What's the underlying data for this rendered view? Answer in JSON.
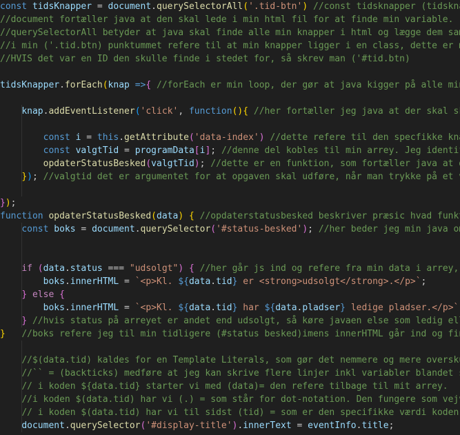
{
  "editor": {
    "language": "javascript",
    "colors": {
      "background": "#1f1f1f",
      "plain": "#cccccc",
      "keyword": "#569cd6",
      "control": "#c586c0",
      "variable": "#9cdcfe",
      "function": "#dcdcaa",
      "string": "#ce9178",
      "comment": "#6a9955",
      "bracket_gold": "#ffd700",
      "bracket_purple": "#da70d6",
      "bracket_blue": "#179fff"
    },
    "lines": [
      [
        [
          "keyword",
          "const "
        ],
        [
          "var",
          "tidsKnapper"
        ],
        [
          "plain",
          " = "
        ],
        [
          "var",
          "document"
        ],
        [
          "plain",
          "."
        ],
        [
          "func",
          "querySelectorAll"
        ],
        [
          "bracket-1",
          "("
        ],
        [
          "string",
          "'.tid-btn'"
        ],
        [
          "bracket-1",
          ")"
        ],
        [
          "plain",
          " "
        ],
        [
          "comment",
          "//const tidsknapper (tidsknap"
        ]
      ],
      [
        [
          "comment",
          "//document fortæller java at den skal lede i min html fil for at finde min variable."
        ]
      ],
      [
        [
          "comment",
          "//querySelectorAll betyder at java skal finde alle min knapper i html og lægge dem samm"
        ]
      ],
      [
        [
          "comment",
          "//i min ('.tid.btn) punktummet refere til at min knapper ligger i en class, dette er me"
        ]
      ],
      [
        [
          "comment",
          "//HVIS det var en ID den skulle finde i stedet for, så skrev man ('#tid.btn)"
        ]
      ],
      [],
      [
        [
          "var",
          "tidsKnapper"
        ],
        [
          "plain",
          "."
        ],
        [
          "func",
          "forEach"
        ],
        [
          "bracket-1",
          "("
        ],
        [
          "var",
          "knap"
        ],
        [
          "plain",
          " "
        ],
        [
          "keyword",
          "=>"
        ],
        [
          "bracket-2",
          "{"
        ],
        [
          "plain",
          " "
        ],
        [
          "comment",
          "//forEach er min loop, der gør at java kigger på alle min"
        ]
      ],
      [],
      [
        [
          "plain",
          "    "
        ],
        [
          "var",
          "knap"
        ],
        [
          "plain",
          "."
        ],
        [
          "func",
          "addEventListener"
        ],
        [
          "bracket-3",
          "("
        ],
        [
          "string",
          "'click'"
        ],
        [
          "plain",
          ", "
        ],
        [
          "keyword",
          "function"
        ],
        [
          "bracket-1",
          "()"
        ],
        [
          "bracket-1",
          "{"
        ],
        [
          "plain",
          " "
        ],
        [
          "comment",
          "//her fortæller jeg java at der skal ske"
        ]
      ],
      [],
      [
        [
          "plain",
          "        "
        ],
        [
          "keyword",
          "const "
        ],
        [
          "var",
          "i"
        ],
        [
          "plain",
          " = "
        ],
        [
          "keyword",
          "this"
        ],
        [
          "plain",
          "."
        ],
        [
          "func",
          "getAttribute"
        ],
        [
          "bracket-2",
          "("
        ],
        [
          "string",
          "'data-index'"
        ],
        [
          "bracket-2",
          ")"
        ],
        [
          "plain",
          " "
        ],
        [
          "comment",
          "//dette refere til den specfikke knap"
        ]
      ],
      [
        [
          "plain",
          "        "
        ],
        [
          "keyword",
          "const "
        ],
        [
          "var",
          "valgtTid"
        ],
        [
          "plain",
          " = "
        ],
        [
          "var",
          "programData"
        ],
        [
          "bracket-2",
          "["
        ],
        [
          "var",
          "i"
        ],
        [
          "bracket-2",
          "]"
        ],
        [
          "plain",
          "; "
        ],
        [
          "comment",
          "//denne del kobles til min arrey. Jeg identifi"
        ]
      ],
      [
        [
          "plain",
          "        "
        ],
        [
          "func",
          "opdaterStatusBesked"
        ],
        [
          "bracket-2",
          "("
        ],
        [
          "var",
          "valgtTid"
        ],
        [
          "bracket-2",
          ")"
        ],
        [
          "plain",
          "; "
        ],
        [
          "comment",
          "//dette er en funktion, som fortæller java at de"
        ]
      ],
      [
        [
          "plain",
          "    "
        ],
        [
          "bracket-1",
          "}"
        ],
        [
          "bracket-3",
          ")"
        ],
        [
          "plain",
          "; "
        ],
        [
          "comment",
          "//valgtid det er argumentet for at opgaven skal udføre, når man trykke på et va"
        ]
      ],
      [],
      [
        [
          "bracket-2",
          "}"
        ],
        [
          "bracket-1",
          ")"
        ],
        [
          "plain",
          ";"
        ]
      ],
      [
        [
          "keyword",
          "function "
        ],
        [
          "func",
          "opdaterStatusBesked"
        ],
        [
          "bracket-1",
          "("
        ],
        [
          "var",
          "data"
        ],
        [
          "bracket-1",
          ")"
        ],
        [
          "plain",
          " "
        ],
        [
          "bracket-1",
          "{"
        ],
        [
          "plain",
          " "
        ],
        [
          "comment",
          "//opdaterstatusbesked beskriver præsic hvad funkti"
        ]
      ],
      [
        [
          "plain",
          "    "
        ],
        [
          "keyword",
          "const "
        ],
        [
          "var",
          "boks"
        ],
        [
          "plain",
          " = "
        ],
        [
          "var",
          "document"
        ],
        [
          "plain",
          "."
        ],
        [
          "func",
          "querySelector"
        ],
        [
          "bracket-2",
          "("
        ],
        [
          "string",
          "'#status-besked'"
        ],
        [
          "bracket-2",
          ")"
        ],
        [
          "plain",
          "; "
        ],
        [
          "comment",
          "//her beder jeg min java om"
        ]
      ],
      [],
      [],
      [
        [
          "plain",
          "    "
        ],
        [
          "control",
          "if"
        ],
        [
          "plain",
          " "
        ],
        [
          "bracket-2",
          "("
        ],
        [
          "var",
          "data"
        ],
        [
          "plain",
          "."
        ],
        [
          "var",
          "status"
        ],
        [
          "plain",
          " === "
        ],
        [
          "string",
          "\"udsolgt\""
        ],
        [
          "bracket-2",
          ")"
        ],
        [
          "plain",
          " "
        ],
        [
          "bracket-2",
          "{"
        ],
        [
          "plain",
          " "
        ],
        [
          "comment",
          "//her går js ind og refere fra min data i arrey, h"
        ]
      ],
      [
        [
          "plain",
          "        "
        ],
        [
          "var",
          "boks"
        ],
        [
          "plain",
          "."
        ],
        [
          "var",
          "innerHTML"
        ],
        [
          "plain",
          " = "
        ],
        [
          "string",
          "`<p>Kl. "
        ],
        [
          "interp",
          "${"
        ],
        [
          "var",
          "data"
        ],
        [
          "plain",
          "."
        ],
        [
          "var",
          "tid"
        ],
        [
          "interp",
          "}"
        ],
        [
          "string",
          " er <strong>udsolgt</strong>.</p>`"
        ],
        [
          "plain",
          ";"
        ]
      ],
      [
        [
          "plain",
          "    "
        ],
        [
          "bracket-2",
          "}"
        ],
        [
          "plain",
          " "
        ],
        [
          "control",
          "else"
        ],
        [
          "plain",
          " "
        ],
        [
          "bracket-2",
          "{"
        ]
      ],
      [
        [
          "plain",
          "        "
        ],
        [
          "var",
          "boks"
        ],
        [
          "plain",
          "."
        ],
        [
          "var",
          "innerHTML"
        ],
        [
          "plain",
          " = "
        ],
        [
          "string",
          "`<p>Kl. "
        ],
        [
          "interp",
          "${"
        ],
        [
          "var",
          "data"
        ],
        [
          "plain",
          "."
        ],
        [
          "var",
          "tid"
        ],
        [
          "interp",
          "}"
        ],
        [
          "string",
          " har "
        ],
        [
          "interp",
          "${"
        ],
        [
          "var",
          "data"
        ],
        [
          "plain",
          "."
        ],
        [
          "var",
          "pladser"
        ],
        [
          "interp",
          "}"
        ],
        [
          "string",
          " ledige pladser.</p>`"
        ],
        [
          "plain",
          ";"
        ]
      ],
      [
        [
          "plain",
          "    "
        ],
        [
          "bracket-2",
          "}"
        ],
        [
          "plain",
          " "
        ],
        [
          "comment",
          "//hvis status på arreyet er andet end udsolgt, så køre javaen else som ledig elle"
        ]
      ],
      [
        [
          "bracket-1",
          "}"
        ],
        [
          "plain",
          "   "
        ],
        [
          "comment",
          "//boks refere jeg til min tidligere (#status besked)imens innerHTML går ind og find"
        ]
      ],
      [],
      [
        [
          "plain",
          "    "
        ],
        [
          "comment",
          "//$(data.tid) kaldes for en Template Literals, som gør det nemmere og mere overskue"
        ]
      ],
      [
        [
          "plain",
          "    "
        ],
        [
          "comment",
          "//`` = (backticks) medføre at jeg kan skrive flere linjer inkl variabler blandet sa"
        ]
      ],
      [
        [
          "plain",
          "    "
        ],
        [
          "comment",
          "// i koden ${data.tid} starter vi med (data)= den refere tilbage til mit arrey."
        ]
      ],
      [
        [
          "plain",
          "    "
        ],
        [
          "comment",
          "//i koden $(data.tid) har vi (.) = som står for dot-notation. Den fungere som vejvi"
        ]
      ],
      [
        [
          "plain",
          "    "
        ],
        [
          "comment",
          "// i koden $(data.tid) har vi til sidst (tid) = som er den specifikke værdi koden l"
        ]
      ],
      [
        [
          "plain",
          "    "
        ],
        [
          "var",
          "document"
        ],
        [
          "plain",
          "."
        ],
        [
          "func",
          "querySelector"
        ],
        [
          "bracket-2",
          "("
        ],
        [
          "string",
          "'#display-title'"
        ],
        [
          "bracket-2",
          ")"
        ],
        [
          "plain",
          "."
        ],
        [
          "var",
          "innerText"
        ],
        [
          "plain",
          " = "
        ],
        [
          "var",
          "eventInfo"
        ],
        [
          "plain",
          "."
        ],
        [
          "var",
          "title"
        ],
        [
          "plain",
          ";"
        ]
      ]
    ]
  }
}
